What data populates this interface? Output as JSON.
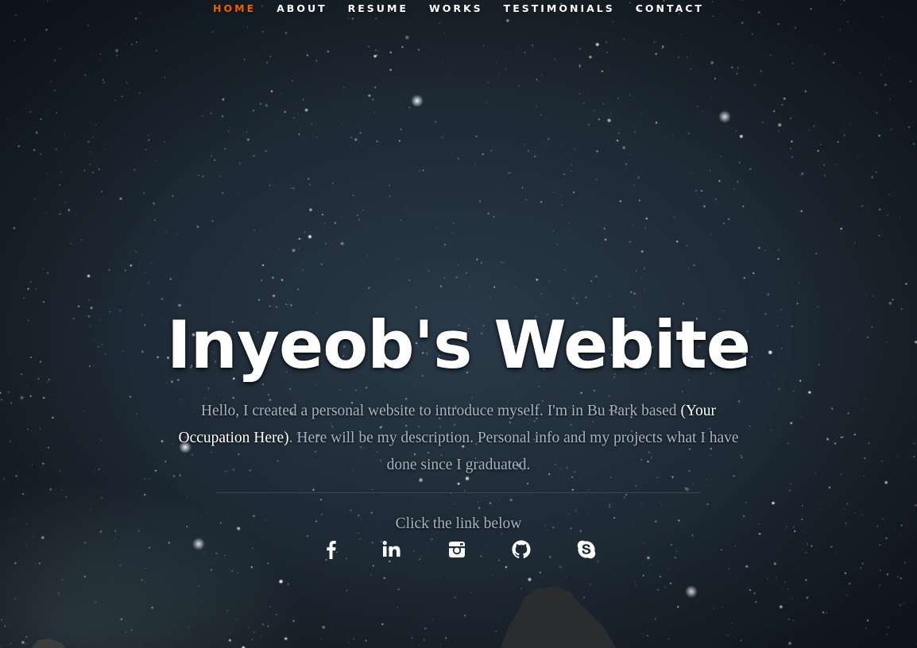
{
  "nav": {
    "items": [
      {
        "label": "HOME",
        "active": true
      },
      {
        "label": "ABOUT",
        "active": false
      },
      {
        "label": "RESUME",
        "active": false
      },
      {
        "label": "WORKS",
        "active": false
      },
      {
        "label": "TESTIMONIALS",
        "active": false
      },
      {
        "label": "CONTACT",
        "active": false
      }
    ]
  },
  "hero": {
    "title": "Inyeob's Webite",
    "intro_pre": "Hello, I created a personal website to introduce myself. I'm in Bu Park based ",
    "intro_occupation": "(Your Occupation Here)",
    "intro_post": ". Here will be my description. Personal info and my projects what I have done since I graduated.",
    "cta": "Click the link below"
  },
  "social": [
    {
      "name": "facebook-icon"
    },
    {
      "name": "linkedin-icon"
    },
    {
      "name": "instagram-icon"
    },
    {
      "name": "github-icon"
    },
    {
      "name": "skype-icon"
    }
  ],
  "colors": {
    "accent": "#f06000",
    "text_muted": "#a9b3bb",
    "background": "#1e2a35"
  }
}
